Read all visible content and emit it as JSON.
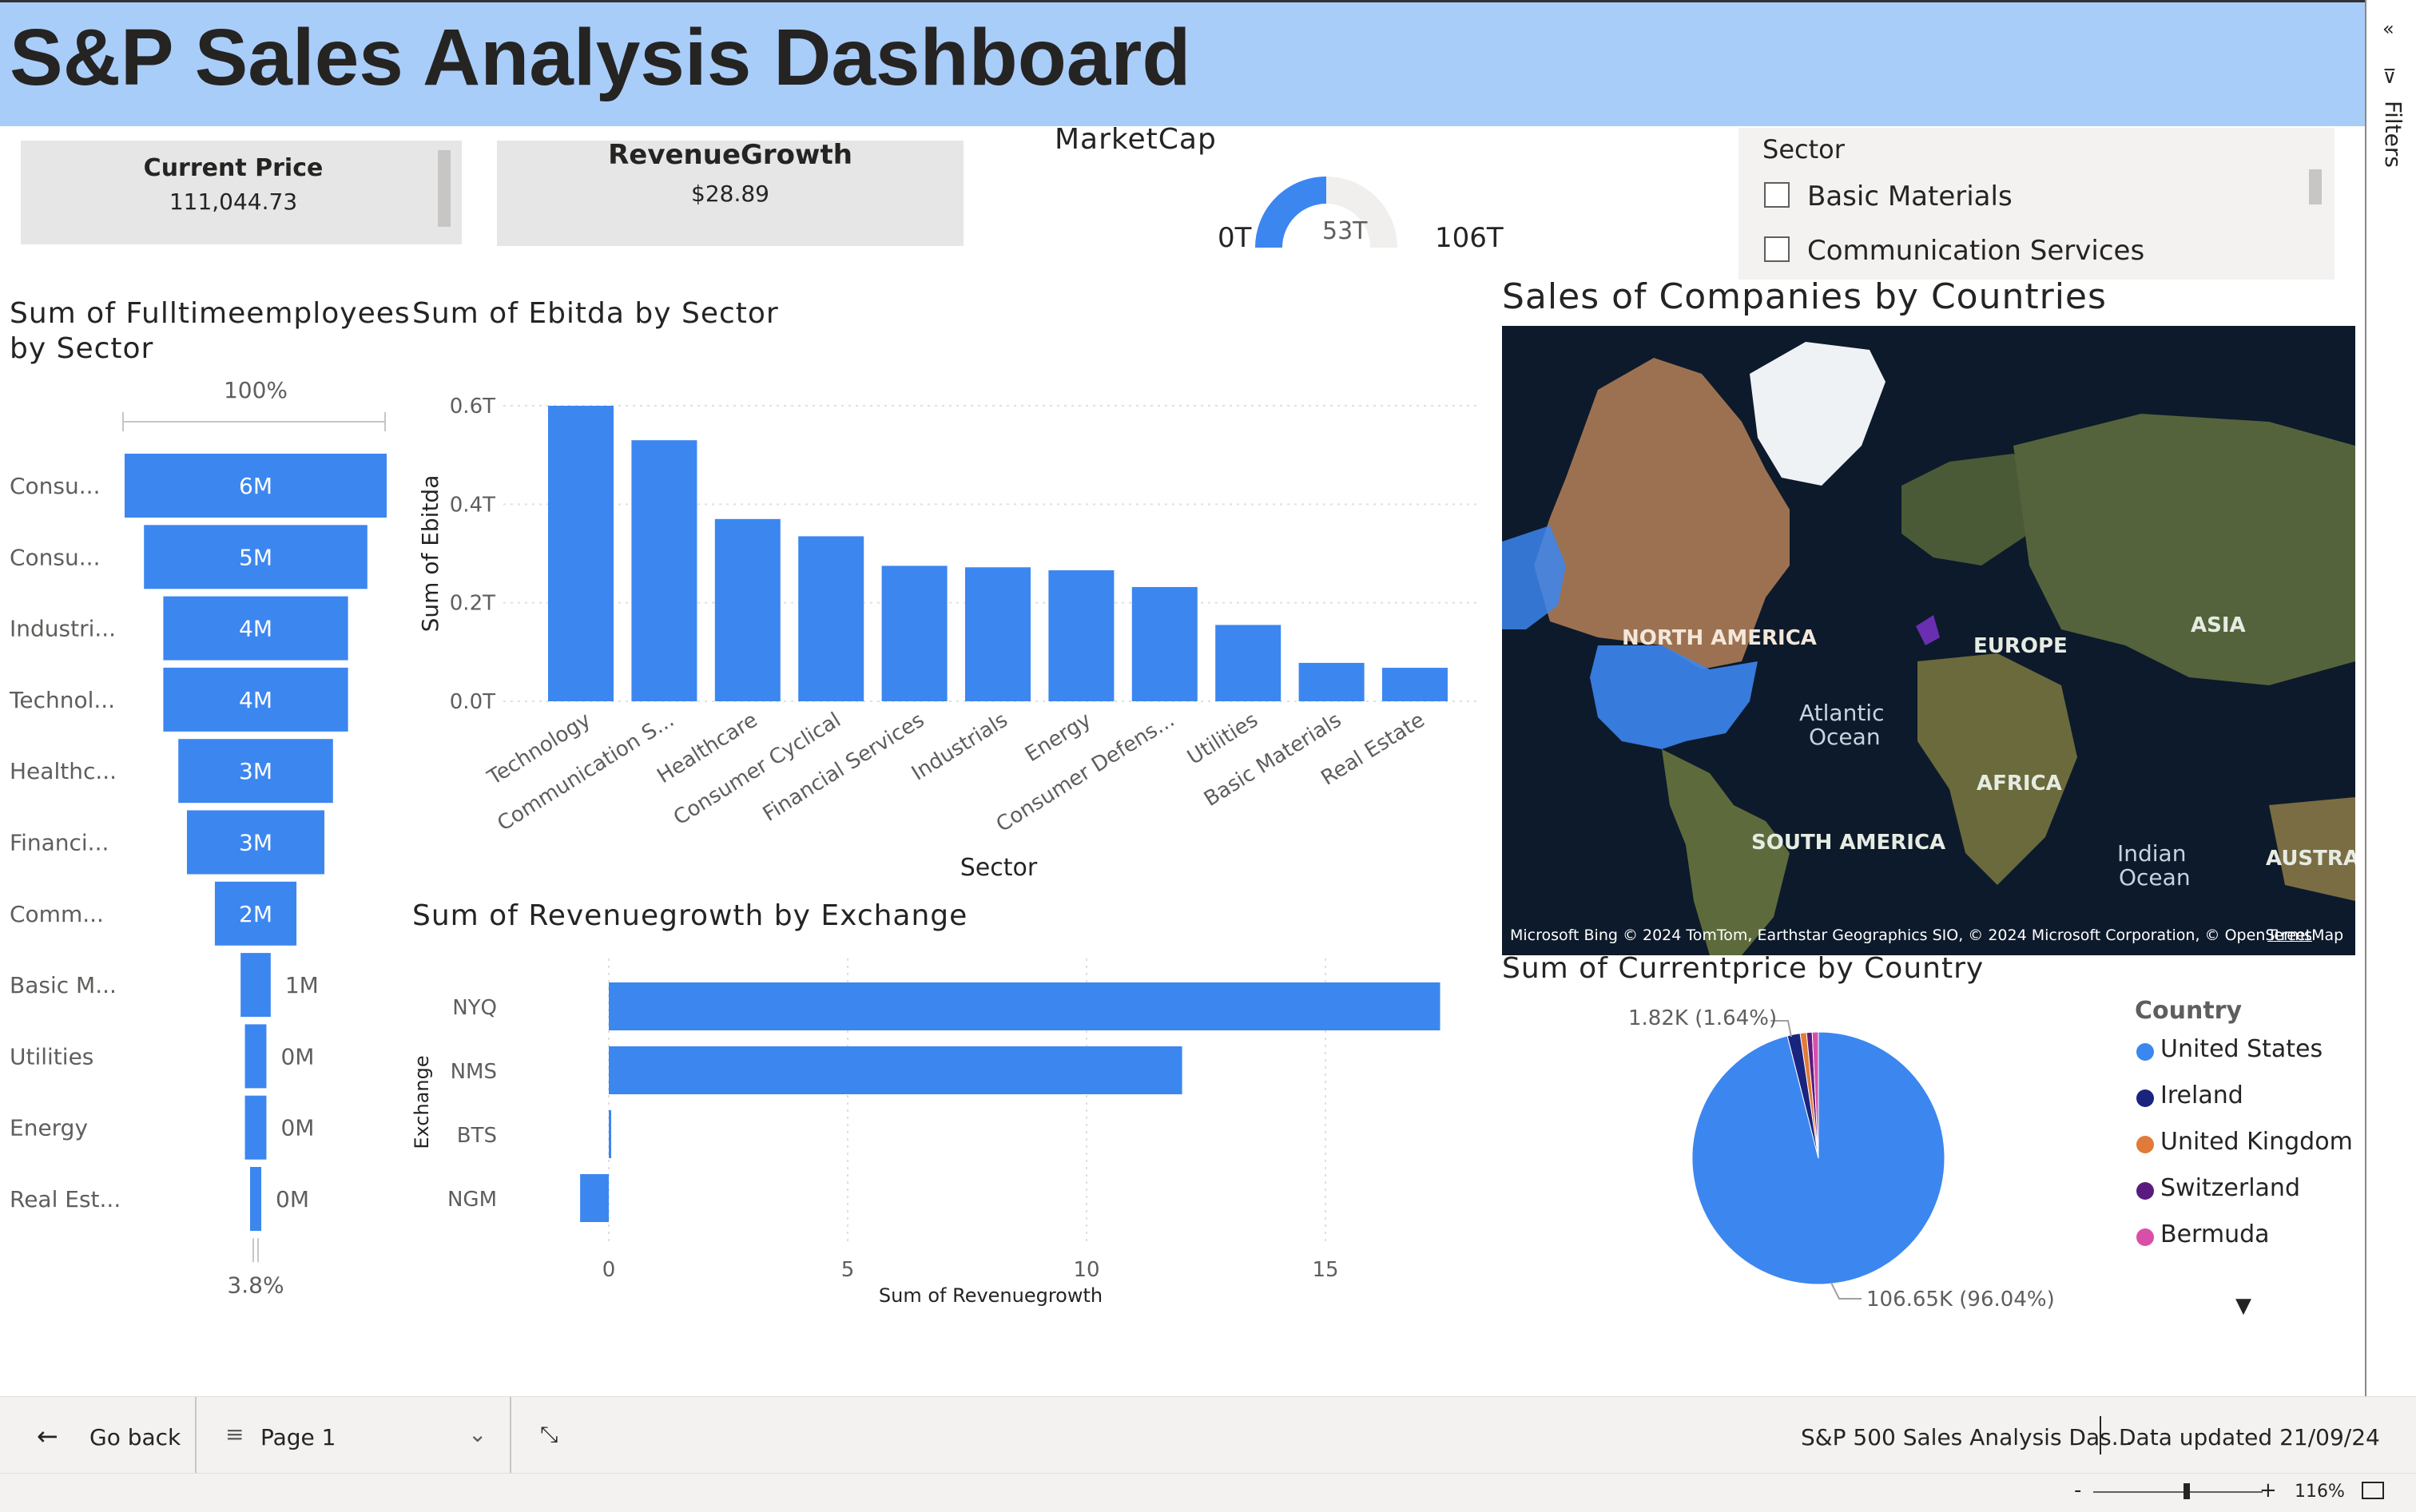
{
  "title": "S&P Sales Analysis Dashboard",
  "cards": {
    "current_price": {
      "label": "Current Price",
      "value": "111,044.73"
    },
    "revenue_growth": {
      "label": "RevenueGrowth",
      "value": "$28.89"
    }
  },
  "marketcap": {
    "title": "MarketCap",
    "min": "0T",
    "value": "53T",
    "max": "106T",
    "fraction": 0.5
  },
  "sector_slicer": {
    "label": "Sector",
    "items": [
      "Basic Materials",
      "Communication Services"
    ]
  },
  "funnel": {
    "title_line1": "Sum of Fulltimeemployees",
    "title_line2": "by Sector",
    "top_pct": "100%",
    "bottom_pct": "3.8%"
  },
  "ebitda": {
    "title": "Sum of Ebitda by Sector"
  },
  "revgrowth": {
    "title": "Sum of Revenuegrowth by Exchange"
  },
  "map": {
    "title": "Sales of Companies by Countries",
    "labels": {
      "north_america": "NORTH AMERICA",
      "europe": "EUROPE",
      "asia": "ASIA",
      "atlantic1": "Atlantic",
      "atlantic2": "Ocean",
      "africa": "AFRICA",
      "south_america": "SOUTH AMERICA",
      "indian1": "Indian",
      "indian2": "Ocean",
      "australia": "AUSTRA"
    },
    "attribution": "Microsoft Bing  © 2024 TomTom, Earthstar Geographics SIO, © 2024 Microsoft Corporation, © OpenStreetMap",
    "terms": "Terms"
  },
  "pie": {
    "title": "Sum of Currentprice by Country",
    "label_small": "1.82K (1.64%)",
    "label_large": "106.65K (96.04%)",
    "legend_title": "Country"
  },
  "filters": {
    "label": "Filters"
  },
  "bottom": {
    "go_back": "Go back",
    "page": "Page 1",
    "report_name": "S&P 500 Sales Analysis Das...",
    "data_updated": "Data updated 21/09/24",
    "zoom": "116%",
    "zoom_level": 0.55
  },
  "chart_data": [
    {
      "type": "bar",
      "orientation": "horizontal-funnel",
      "title": "Sum of Fulltimeemployees by Sector",
      "categories": [
        "Consu...",
        "Consu...",
        "Industri...",
        "Technol...",
        "Healthc...",
        "Financi...",
        "Comm...",
        "Basic M...",
        "Utilities",
        "Energy",
        "Real Est..."
      ],
      "values": [
        6.1,
        5.2,
        4.3,
        4.3,
        3.6,
        3.2,
        1.9,
        0.7,
        0.5,
        0.5,
        0.23
      ],
      "data_labels": [
        "6M",
        "5M",
        "4M",
        "4M",
        "3M",
        "3M",
        "2M",
        "1M",
        "0M",
        "0M",
        "0M"
      ],
      "unit": "M"
    },
    {
      "type": "bar",
      "title": "Sum of Ebitda by Sector",
      "xlabel": "Sector",
      "ylabel": "Sum of Ebitda",
      "categories": [
        "Technology",
        "Communication S...",
        "Healthcare",
        "Consumer Cyclical",
        "Financial Services",
        "Industrials",
        "Energy",
        "Consumer Defens...",
        "Utilities",
        "Basic Materials",
        "Real Estate"
      ],
      "values": [
        0.6,
        0.53,
        0.37,
        0.335,
        0.275,
        0.272,
        0.266,
        0.232,
        0.155,
        0.078,
        0.068
      ],
      "yticks": [
        "0.0T",
        "0.2T",
        "0.4T",
        "0.6T"
      ],
      "ylim": [
        0,
        0.6
      ],
      "unit": "T",
      "color": "#3c86f0"
    },
    {
      "type": "bar",
      "orientation": "horizontal",
      "title": "Sum of Revenuegrowth by Exchange",
      "xlabel": "Sum of Revenuegrowth",
      "ylabel": "Exchange",
      "categories": [
        "NYQ",
        "NMS",
        "BTS",
        "NGM"
      ],
      "values": [
        17.4,
        12.0,
        0.05,
        -0.6
      ],
      "xticks": [
        "0",
        "5",
        "10",
        "15"
      ],
      "xlim": [
        -0.6,
        17.4
      ],
      "color": "#3c86f0"
    },
    {
      "type": "pie",
      "title": "Sum of Currentprice by Country",
      "legend_title": "Country",
      "labels": [
        "United States",
        "Ireland",
        "United Kingdom",
        "Switzerland",
        "Bermuda"
      ],
      "values": [
        106.65,
        1.82,
        0.9,
        0.8,
        0.87
      ],
      "colors": [
        "#3c86f0",
        "#1a237e",
        "#e07b39",
        "#5b1b7e",
        "#d94fa8"
      ],
      "legend": "right"
    }
  ]
}
